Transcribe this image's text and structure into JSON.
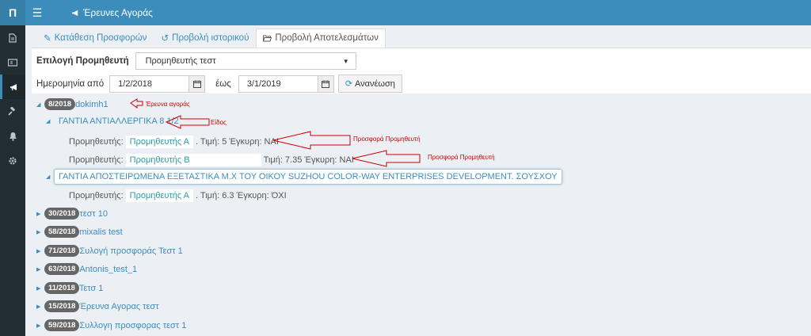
{
  "sidebar": {
    "logo": "Π",
    "icons": [
      "document-icon",
      "id-card-icon",
      "megaphone-icon",
      "gavel-icon",
      "bell-icon",
      "gear-icon"
    ]
  },
  "header": {
    "title": "Έρευνες Αγοράς"
  },
  "tabs": [
    {
      "label": "Κατάθεση Προσφορών"
    },
    {
      "label": "Προβολή ιστορικού"
    },
    {
      "label": "Προβολή Αποτελεσμάτων"
    }
  ],
  "filters": {
    "supplier_label": "Επιλογή Προμηθευτή",
    "supplier_value": "Προμηθευτής τεστ",
    "date_from_label": "Ημερομηνία από",
    "date_from": "1/2/2018",
    "date_to_label": "έως",
    "date_to": "3/1/2019",
    "refresh_label": "Ανανέωση"
  },
  "tree": {
    "expanded": {
      "badge": "8/2018",
      "label": "dokimh1",
      "items": [
        {
          "label": "ΓΑΝΤΙΑ ΑΝΤΙΑΛΛΕΡΓΙΚΑ 8 1/2",
          "offers": [
            {
              "prefix": "Προμηθευτής:",
              "supplier": "Προμηθευτής Α",
              "details": ". Τιμή: 5 Έγκυρη: ΝΑΙ"
            },
            {
              "prefix": "Προμηθευτής:",
              "supplier": "Προμηθευτής Β",
              "details": "Τιμή: 7.35 Έγκυρη: ΝΑΙ"
            }
          ]
        },
        {
          "label": "ΓΑΝΤΙΑ ΑΠΟΣΤΕΙΡΩΜΕΝΑ ΕΞΕΤΑΣΤΙΚΑ Μ.Χ ΤΟΥ ΟΙΚΟΥ SUZHOU COLOR-WAY ENTERPRISES DEVELOPMENT. ΣΟΥΣΧΟΥ",
          "offers": [
            {
              "prefix": "Προμηθευτής:",
              "supplier": "Προμηθευτής Α",
              "details": ". Τιμή: 6.3 Έγκυρη: ΌΧΙ"
            }
          ]
        }
      ]
    },
    "collapsed": [
      {
        "badge": "30/2018",
        "label": "τεστ 10"
      },
      {
        "badge": "58/2018",
        "label": "mixalis test"
      },
      {
        "badge": "71/2018",
        "label": "Συλογή προσφοράς Τεστ 1"
      },
      {
        "badge": "63/2018",
        "label": "Antonis_test_1"
      },
      {
        "badge": "11/2018",
        "label": "Τετσ 1"
      },
      {
        "badge": "15/2018",
        "label": "Έρευνα Αγορας τεστ"
      },
      {
        "badge": "59/2018",
        "label": "Συλλογη προσφορας τεστ 1"
      }
    ]
  },
  "annotations": {
    "research": "Έρευνα αγοράς",
    "item": "Είδος",
    "offer_1": "Προσφορά Προμηθευτή",
    "offer_2": "Προσφορά Προμηθευτή",
    "color": "#cc0000"
  }
}
